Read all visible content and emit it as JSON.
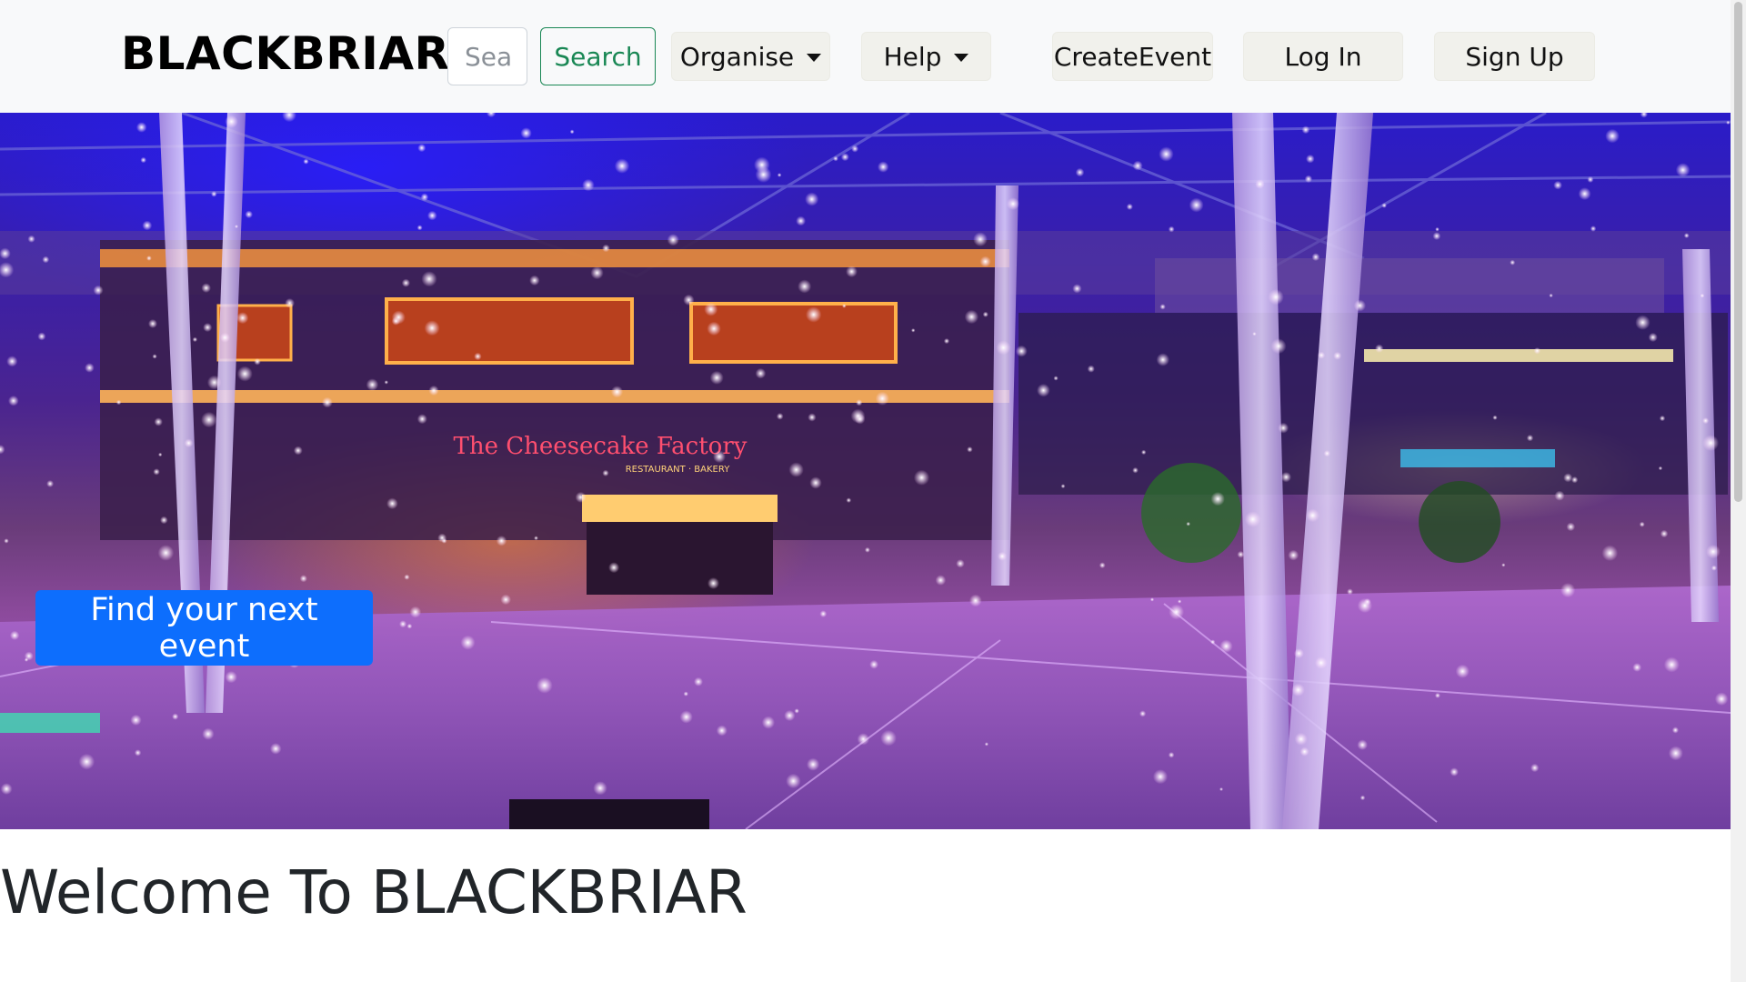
{
  "navbar": {
    "brand": "BLACKBRIAR",
    "search": {
      "placeholder": "Search",
      "button_label": "Search"
    },
    "organise_label": "Organise",
    "help_label": "Help",
    "create_event_label": "CreateEvent",
    "login_label": "Log In",
    "signup_label": "Sign Up"
  },
  "hero": {
    "cta_label": "Find your next event",
    "banner_texts": [
      "The Cheesecake Factory",
      "RESTAURANT · BAKERY"
    ]
  },
  "main": {
    "heading": "Welcome To BLACKBRIAR"
  },
  "colors": {
    "navbar_bg": "#f8f9fa",
    "search_button": "#198754",
    "primary": "#0d6efd",
    "nav_button_bg": "#f1f1ec",
    "heading_text": "#212529"
  },
  "icons": {
    "dropdown": "caret-down-icon"
  }
}
